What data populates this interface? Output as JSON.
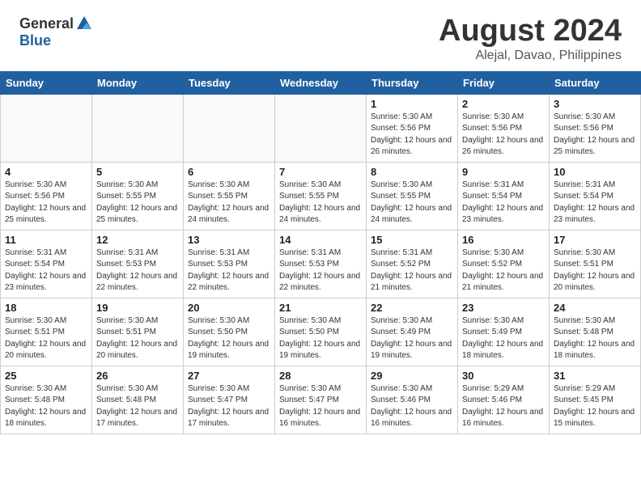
{
  "header": {
    "logo_general": "General",
    "logo_blue": "Blue",
    "main_title": "August 2024",
    "sub_title": "Alejal, Davao, Philippines"
  },
  "calendar": {
    "days_of_week": [
      "Sunday",
      "Monday",
      "Tuesday",
      "Wednesday",
      "Thursday",
      "Friday",
      "Saturday"
    ],
    "weeks": [
      [
        {
          "day": "",
          "info": ""
        },
        {
          "day": "",
          "info": ""
        },
        {
          "day": "",
          "info": ""
        },
        {
          "day": "",
          "info": ""
        },
        {
          "day": "1",
          "info": "Sunrise: 5:30 AM\nSunset: 5:56 PM\nDaylight: 12 hours\nand 26 minutes."
        },
        {
          "day": "2",
          "info": "Sunrise: 5:30 AM\nSunset: 5:56 PM\nDaylight: 12 hours\nand 26 minutes."
        },
        {
          "day": "3",
          "info": "Sunrise: 5:30 AM\nSunset: 5:56 PM\nDaylight: 12 hours\nand 25 minutes."
        }
      ],
      [
        {
          "day": "4",
          "info": "Sunrise: 5:30 AM\nSunset: 5:56 PM\nDaylight: 12 hours\nand 25 minutes."
        },
        {
          "day": "5",
          "info": "Sunrise: 5:30 AM\nSunset: 5:55 PM\nDaylight: 12 hours\nand 25 minutes."
        },
        {
          "day": "6",
          "info": "Sunrise: 5:30 AM\nSunset: 5:55 PM\nDaylight: 12 hours\nand 24 minutes."
        },
        {
          "day": "7",
          "info": "Sunrise: 5:30 AM\nSunset: 5:55 PM\nDaylight: 12 hours\nand 24 minutes."
        },
        {
          "day": "8",
          "info": "Sunrise: 5:30 AM\nSunset: 5:55 PM\nDaylight: 12 hours\nand 24 minutes."
        },
        {
          "day": "9",
          "info": "Sunrise: 5:31 AM\nSunset: 5:54 PM\nDaylight: 12 hours\nand 23 minutes."
        },
        {
          "day": "10",
          "info": "Sunrise: 5:31 AM\nSunset: 5:54 PM\nDaylight: 12 hours\nand 23 minutes."
        }
      ],
      [
        {
          "day": "11",
          "info": "Sunrise: 5:31 AM\nSunset: 5:54 PM\nDaylight: 12 hours\nand 23 minutes."
        },
        {
          "day": "12",
          "info": "Sunrise: 5:31 AM\nSunset: 5:53 PM\nDaylight: 12 hours\nand 22 minutes."
        },
        {
          "day": "13",
          "info": "Sunrise: 5:31 AM\nSunset: 5:53 PM\nDaylight: 12 hours\nand 22 minutes."
        },
        {
          "day": "14",
          "info": "Sunrise: 5:31 AM\nSunset: 5:53 PM\nDaylight: 12 hours\nand 22 minutes."
        },
        {
          "day": "15",
          "info": "Sunrise: 5:31 AM\nSunset: 5:52 PM\nDaylight: 12 hours\nand 21 minutes."
        },
        {
          "day": "16",
          "info": "Sunrise: 5:30 AM\nSunset: 5:52 PM\nDaylight: 12 hours\nand 21 minutes."
        },
        {
          "day": "17",
          "info": "Sunrise: 5:30 AM\nSunset: 5:51 PM\nDaylight: 12 hours\nand 20 minutes."
        }
      ],
      [
        {
          "day": "18",
          "info": "Sunrise: 5:30 AM\nSunset: 5:51 PM\nDaylight: 12 hours\nand 20 minutes."
        },
        {
          "day": "19",
          "info": "Sunrise: 5:30 AM\nSunset: 5:51 PM\nDaylight: 12 hours\nand 20 minutes."
        },
        {
          "day": "20",
          "info": "Sunrise: 5:30 AM\nSunset: 5:50 PM\nDaylight: 12 hours\nand 19 minutes."
        },
        {
          "day": "21",
          "info": "Sunrise: 5:30 AM\nSunset: 5:50 PM\nDaylight: 12 hours\nand 19 minutes."
        },
        {
          "day": "22",
          "info": "Sunrise: 5:30 AM\nSunset: 5:49 PM\nDaylight: 12 hours\nand 19 minutes."
        },
        {
          "day": "23",
          "info": "Sunrise: 5:30 AM\nSunset: 5:49 PM\nDaylight: 12 hours\nand 18 minutes."
        },
        {
          "day": "24",
          "info": "Sunrise: 5:30 AM\nSunset: 5:48 PM\nDaylight: 12 hours\nand 18 minutes."
        }
      ],
      [
        {
          "day": "25",
          "info": "Sunrise: 5:30 AM\nSunset: 5:48 PM\nDaylight: 12 hours\nand 18 minutes."
        },
        {
          "day": "26",
          "info": "Sunrise: 5:30 AM\nSunset: 5:48 PM\nDaylight: 12 hours\nand 17 minutes."
        },
        {
          "day": "27",
          "info": "Sunrise: 5:30 AM\nSunset: 5:47 PM\nDaylight: 12 hours\nand 17 minutes."
        },
        {
          "day": "28",
          "info": "Sunrise: 5:30 AM\nSunset: 5:47 PM\nDaylight: 12 hours\nand 16 minutes."
        },
        {
          "day": "29",
          "info": "Sunrise: 5:30 AM\nSunset: 5:46 PM\nDaylight: 12 hours\nand 16 minutes."
        },
        {
          "day": "30",
          "info": "Sunrise: 5:29 AM\nSunset: 5:46 PM\nDaylight: 12 hours\nand 16 minutes."
        },
        {
          "day": "31",
          "info": "Sunrise: 5:29 AM\nSunset: 5:45 PM\nDaylight: 12 hours\nand 15 minutes."
        }
      ]
    ]
  }
}
